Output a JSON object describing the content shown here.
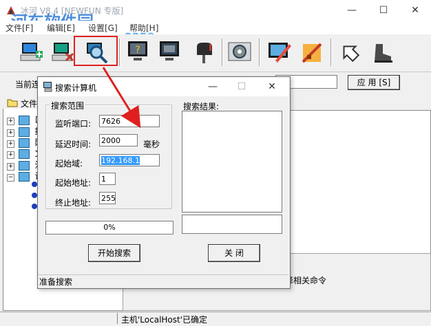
{
  "window": {
    "title": "冰河 V8.4 [NEWFUN 专版]",
    "controls": [
      "—",
      "☐",
      "✕"
    ]
  },
  "watermark": {
    "text": "河东软件园",
    "url": "www.pc0359.cn"
  },
  "menu": [
    {
      "label": "文件[F]"
    },
    {
      "label": "编辑[E]"
    },
    {
      "label": "设置[G]"
    },
    {
      "label": "帮助[H]"
    }
  ],
  "toolbar": {
    "buttons": [
      {
        "name": "add-host",
        "icon": "computer-add-icon"
      },
      {
        "name": "delete-host",
        "icon": "computer-delete-icon"
      },
      {
        "name": "search-host",
        "icon": "magnifier-icon"
      },
      {
        "name": "help",
        "icon": "question-monitor-icon"
      },
      {
        "name": "screen",
        "icon": "monitor-icon"
      },
      {
        "name": "mail",
        "icon": "mailbox-icon"
      },
      {
        "name": "config",
        "icon": "gear-panel-icon"
      },
      {
        "name": "edit",
        "icon": "pen-monitor-icon"
      },
      {
        "name": "tools",
        "icon": "tools-icon"
      },
      {
        "name": "back",
        "icon": "arrow-back-icon"
      },
      {
        "name": "boot",
        "icon": "boot-icon"
      }
    ]
  },
  "bar2": {
    "current_label": "当前连",
    "apply_button": "应 用 [S]"
  },
  "tree": {
    "header": "文件",
    "items": [
      "口",
      "控",
      "网",
      "文",
      "注",
      "设"
    ]
  },
  "right": {
    "hint": "择相关命令"
  },
  "status": {
    "text": "主机'LocalHost'已确定"
  },
  "dialog": {
    "title": "搜索计算机",
    "controls": [
      "—",
      "☐",
      "✕"
    ],
    "group_label": "搜索范围",
    "fields": {
      "port_label": "监听端口:",
      "port_value": "7626",
      "delay_label": "延迟时间:",
      "delay_value": "2000",
      "delay_unit": "毫秒",
      "domain_label": "起始域:",
      "domain_value": "192.168.1",
      "start_label": "起始地址:",
      "start_value": "1",
      "end_label": "终止地址:",
      "end_value": "255"
    },
    "results_label": "搜索结果:",
    "progress": "0%",
    "progress_value": 0,
    "start_button": "开始搜索",
    "close_button": "关 闭",
    "status": "准备搜索"
  },
  "colors": {
    "highlight": "#e02020",
    "selection": "#3399ff",
    "watermark": "#3b83d8"
  }
}
